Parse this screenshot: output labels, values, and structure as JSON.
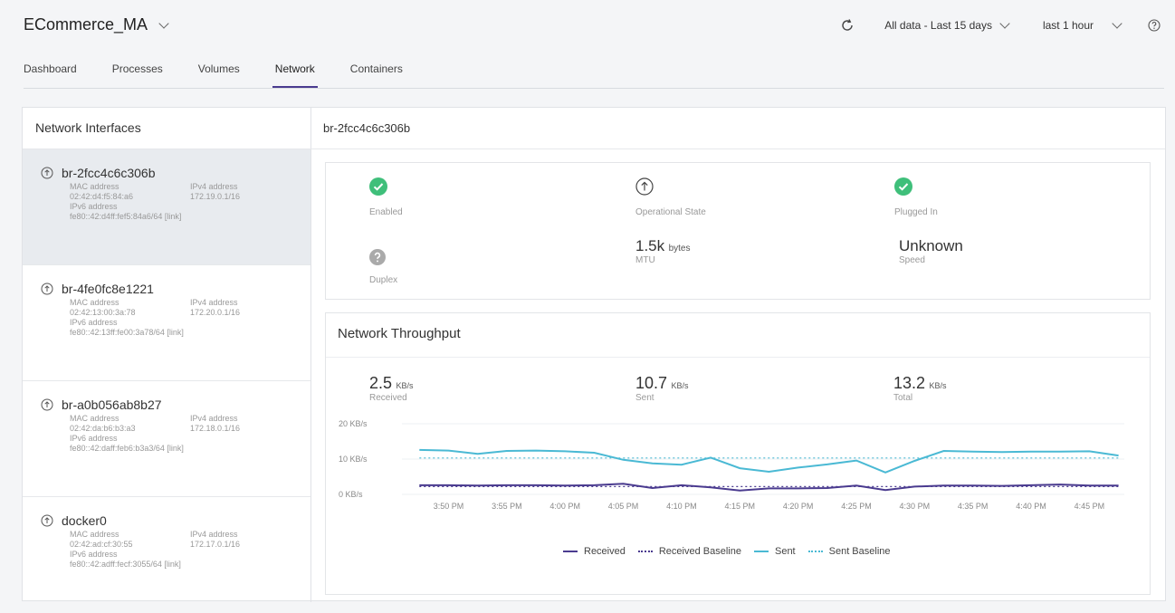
{
  "app": {
    "title": "ECommerce_MA"
  },
  "header": {
    "range_label": "All data - Last 15 days",
    "time_label": "last 1 hour"
  },
  "tabs": [
    {
      "label": "Dashboard"
    },
    {
      "label": "Processes"
    },
    {
      "label": "Volumes"
    },
    {
      "label": "Network",
      "active": true
    },
    {
      "label": "Containers"
    }
  ],
  "interfaces_panel": {
    "title": "Network Interfaces",
    "mac_label": "MAC address",
    "ipv4_label": "IPv4 address",
    "ipv6_label": "IPv6 address",
    "items": [
      {
        "name": "br-2fcc4c6c306b",
        "mac": "02:42:d4:f5:84:a6",
        "ipv4": "172.19.0.1/16",
        "ipv6": "fe80::42:d4ff:fef5:84a6/64 [link]",
        "selected": true
      },
      {
        "name": "br-4fe0fc8e1221",
        "mac": "02:42:13:00:3a:78",
        "ipv4": "172.20.0.1/16",
        "ipv6": "fe80::42:13ff:fe00:3a78/64 [link]"
      },
      {
        "name": "br-a0b056ab8b27",
        "mac": "02:42:da:b6:b3:a3",
        "ipv4": "172.18.0.1/16",
        "ipv6": "fe80::42:daff:feb6:b3a3/64 [link]"
      },
      {
        "name": "docker0",
        "mac": "02:42:ad:cf:30:55",
        "ipv4": "172.17.0.1/16",
        "ipv6": "fe80::42:adff:fecf:3055/64 [link]"
      }
    ]
  },
  "detail": {
    "title": "br-2fcc4c6c306b",
    "enabled_label": "Enabled",
    "operational_label": "Operational State",
    "plugged_label": "Plugged In",
    "duplex_label": "Duplex",
    "mtu_value": "1.5k",
    "mtu_unit": "bytes",
    "mtu_label": "MTU",
    "speed_value": "Unknown",
    "speed_label": "Speed"
  },
  "throughput": {
    "title": "Network Throughput",
    "received_value": "2.5",
    "received_unit": "KB/s",
    "received_label": "Received",
    "sent_value": "10.7",
    "sent_unit": "KB/s",
    "sent_label": "Sent",
    "total_value": "13.2",
    "total_unit": "KB/s",
    "total_label": "Total"
  },
  "legend": {
    "received": "Received",
    "received_baseline": "Received Baseline",
    "sent": "Sent",
    "sent_baseline": "Sent Baseline"
  },
  "colors": {
    "received": "#4a3b8f",
    "sent": "#4ab9d4",
    "green": "#3fbf7a",
    "accent": "#4a3b8f"
  },
  "chart_data": {
    "type": "line",
    "y_ticks": [
      "20 KB/s",
      "10 KB/s",
      "0 KB/s"
    ],
    "ylim": [
      0,
      20
    ],
    "x_ticks": [
      "3:50 PM",
      "3:55 PM",
      "4:00 PM",
      "4:05 PM",
      "4:10 PM",
      "4:15 PM",
      "4:20 PM",
      "4:25 PM",
      "4:30 PM",
      "4:35 PM",
      "4:40 PM",
      "4:45 PM"
    ],
    "x_minutes": [
      -2.5,
      0,
      2.5,
      5,
      7.5,
      10,
      12.5,
      15,
      17.5,
      20,
      22.5,
      25,
      27.5,
      30,
      32.5,
      35,
      37.5,
      40,
      42.5,
      45,
      47.5,
      50,
      52.5,
      55,
      57.5
    ],
    "series": [
      {
        "name": "Received",
        "values": [
          2.6,
          2.6,
          2.5,
          2.6,
          2.6,
          2.5,
          2.6,
          3.0,
          1.8,
          2.6,
          2.0,
          1.1,
          1.7,
          1.7,
          1.8,
          2.5,
          1.2,
          2.2,
          2.5,
          2.5,
          2.4,
          2.6,
          2.8,
          2.5,
          2.5
        ]
      },
      {
        "name": "Sent",
        "values": [
          12.6,
          12.4,
          11.5,
          12.3,
          12.4,
          12.2,
          11.8,
          9.8,
          8.8,
          8.4,
          10.4,
          7.4,
          6.4,
          7.6,
          8.5,
          9.6,
          6.2,
          9.5,
          12.3,
          12.1,
          12.0,
          12.1,
          12.1,
          12.2,
          11.0
        ]
      },
      {
        "name": "Received Baseline",
        "values": [
          2.2,
          2.2,
          2.2,
          2.2,
          2.2,
          2.2,
          2.2,
          2.2,
          2.2,
          2.2,
          2.2,
          2.2,
          2.2,
          2.2,
          2.2,
          2.2,
          2.2,
          2.2,
          2.2,
          2.2,
          2.2,
          2.2,
          2.2,
          2.2,
          2.2
        ]
      },
      {
        "name": "Sent Baseline",
        "values": [
          10.3,
          10.3,
          10.3,
          10.3,
          10.3,
          10.3,
          10.3,
          10.3,
          10.3,
          10.3,
          10.3,
          10.3,
          10.3,
          10.3,
          10.3,
          10.3,
          10.3,
          10.3,
          10.3,
          10.3,
          10.3,
          10.3,
          10.3,
          10.3,
          10.3
        ]
      }
    ]
  }
}
